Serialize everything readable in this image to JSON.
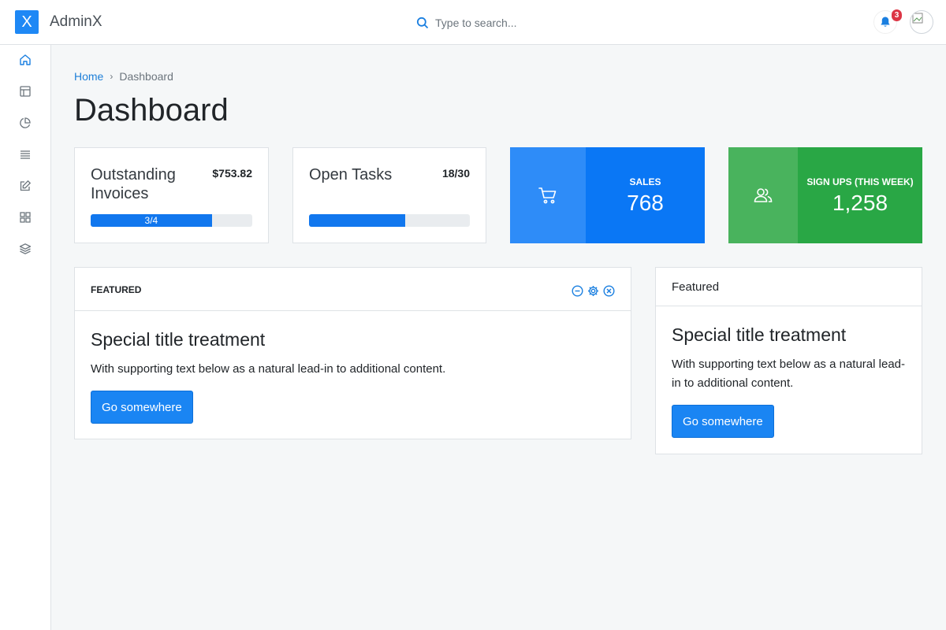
{
  "header": {
    "logo_letter": "X",
    "app_name": "AdminX",
    "search_placeholder": "Type to search...",
    "notification_count": "3"
  },
  "sidebar": {
    "items": [
      {
        "icon": "home-icon"
      },
      {
        "icon": "layout-icon"
      },
      {
        "icon": "pie-chart-icon"
      },
      {
        "icon": "list-icon"
      },
      {
        "icon": "edit-icon"
      },
      {
        "icon": "grid-icon"
      },
      {
        "icon": "layers-icon"
      }
    ]
  },
  "breadcrumb": {
    "home": "Home",
    "separator": "›",
    "current": "Dashboard"
  },
  "page": {
    "title": "Dashboard"
  },
  "stats": {
    "invoices": {
      "label": "Outstanding Invoices",
      "value": "$753.82",
      "progress_label": "3/4",
      "progress": 0.75
    },
    "tasks": {
      "label": "Open Tasks",
      "value": "18/30",
      "progress": 0.6
    },
    "sales": {
      "label": "SALES",
      "value": "768",
      "icon": "cart-icon",
      "color": "#0a77f5"
    },
    "signups": {
      "label": "SIGN UPS (THIS WEEK)",
      "value": "1,258",
      "icon": "users-icon",
      "color": "#29a745"
    }
  },
  "featured_main": {
    "header": "FEATURED",
    "title": "Special title treatment",
    "text": "With supporting text below as a natural lead-in to additional content.",
    "button": "Go somewhere"
  },
  "featured_side": {
    "header": "Featured",
    "title": "Special title treatment",
    "text": "With supporting text below as a natural lead-in to additional content.",
    "button": "Go somewhere"
  },
  "colors": {
    "accent": "#1a85f3",
    "danger": "#dc3545",
    "success": "#29a745"
  }
}
